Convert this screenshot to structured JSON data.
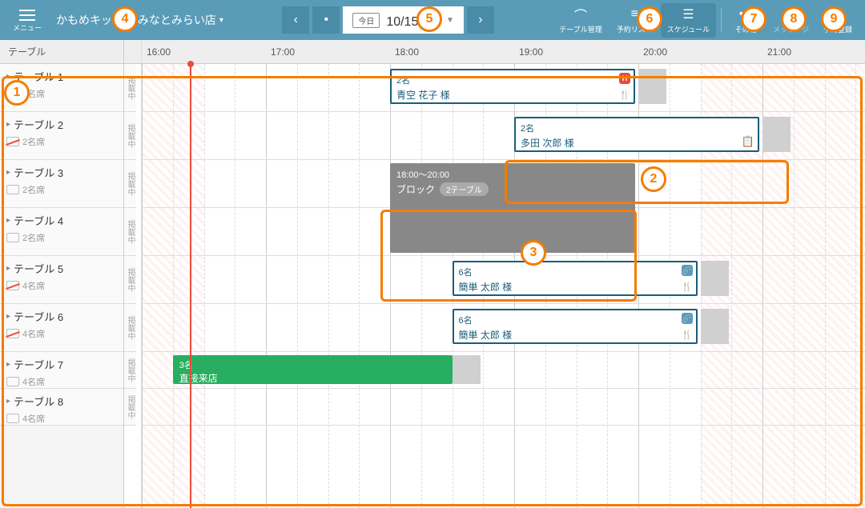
{
  "header": {
    "menu_label": "メニュー",
    "store_name": "かもめキッチン みなとみらい店",
    "today_badge": "今日",
    "date_text": "10/15(火)",
    "tools": {
      "table_mgmt": "テーブル管理",
      "reserve_list": "予約リスト",
      "schedule": "スケジュール",
      "other": "その他",
      "message": "メッセージ",
      "add_reserve": "予約登録"
    }
  },
  "sidebar_header": "テーブル",
  "status_label": "掲載中",
  "time_slots": [
    "16:00",
    "17:00",
    "18:00",
    "19:00",
    "20:00",
    "21:00"
  ],
  "tables": [
    {
      "name": "テーブル 1",
      "seats": "2名席",
      "red": true
    },
    {
      "name": "テーブル 2",
      "seats": "2名席",
      "red": true
    },
    {
      "name": "テーブル 3",
      "seats": "2名席",
      "red": false
    },
    {
      "name": "テーブル 4",
      "seats": "2名席",
      "red": false
    },
    {
      "name": "テーブル 5",
      "seats": "4名席",
      "red": true
    },
    {
      "name": "テーブル 6",
      "seats": "4名席",
      "red": true
    },
    {
      "name": "テーブル 7",
      "seats": "4名席",
      "red": false
    },
    {
      "name": "テーブル 8",
      "seats": "4名席",
      "red": false
    }
  ],
  "events": {
    "e1": {
      "guests": "2名",
      "name": "青空 花子 様"
    },
    "e2": {
      "guests": "2名",
      "name": "多田 次郎 様"
    },
    "e5": {
      "guests": "6名",
      "name": "簡単 太郎 様"
    },
    "e6": {
      "guests": "6名",
      "name": "簡単 太郎 様"
    },
    "walkin": {
      "guests": "3名",
      "name": "直接来店"
    },
    "block": {
      "time": "18:00～20:00",
      "label": "ブロック",
      "count": "2テーブル"
    }
  },
  "callouts": [
    "1",
    "2",
    "3",
    "4",
    "5",
    "6",
    "7",
    "8",
    "9"
  ]
}
